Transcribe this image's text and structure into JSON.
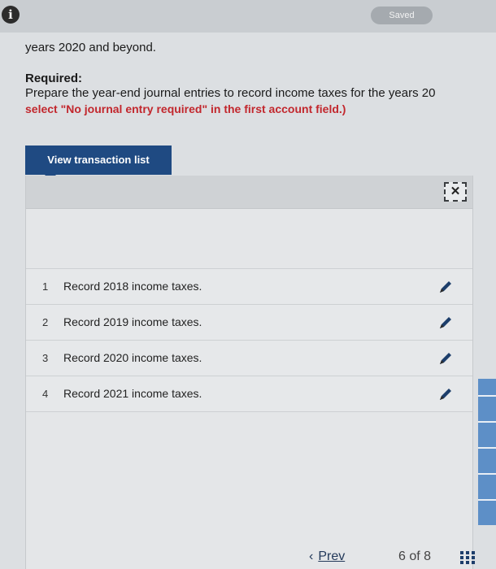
{
  "header": {
    "info_icon": "i",
    "saved_label": "Saved"
  },
  "question": {
    "intro_text": "years 2020 and beyond.",
    "required_title": "Required:",
    "required_text": "Prepare the year-end journal entries to record income taxes for the years 20",
    "required_note": "select \"No journal entry required\" in the first account field.)"
  },
  "transaction_panel": {
    "view_button_label": "View transaction list",
    "close_symbol": "✕",
    "items": [
      {
        "number": "1",
        "label": "Record 2018 income taxes."
      },
      {
        "number": "2",
        "label": "Record 2019 income taxes."
      },
      {
        "number": "3",
        "label": "Record 2020 income taxes."
      },
      {
        "number": "4",
        "label": "Record 2021 income taxes."
      }
    ],
    "edit_icon": "pencil-icon"
  },
  "pager": {
    "prev_arrow": "‹",
    "prev_label": "Prev",
    "page_text": "6 of 8"
  },
  "colors": {
    "button_bg": "#1f4a82",
    "note_red": "#c2272d",
    "pencil_blue": "#1d3e6b"
  }
}
